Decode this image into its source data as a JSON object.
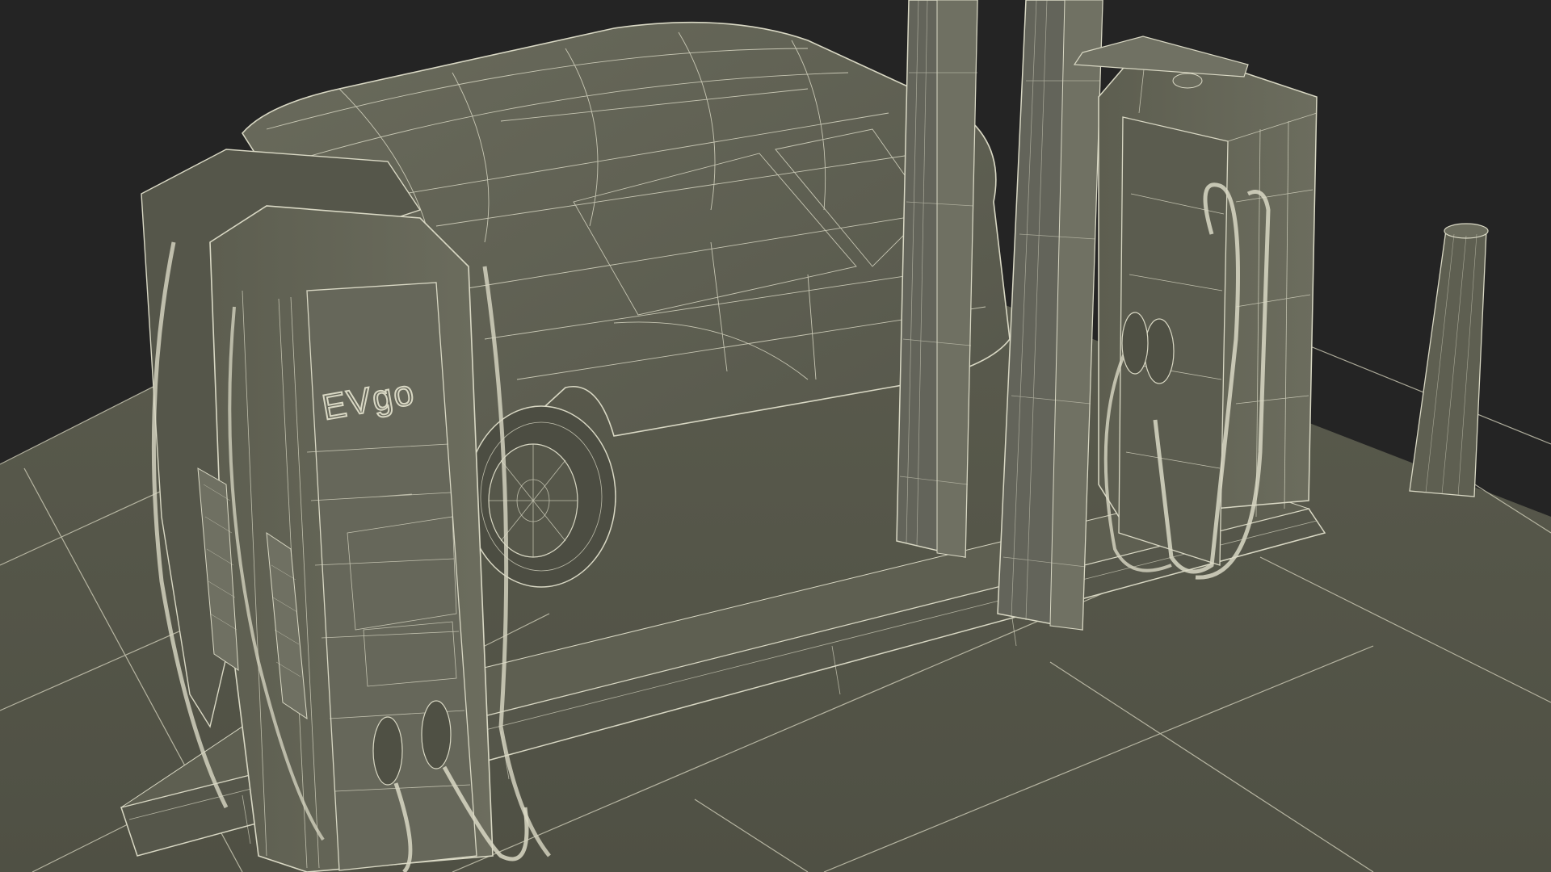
{
  "scene": {
    "description_type": "3d-wireframe-render",
    "colors": {
      "background": "#242424",
      "surface": "#5a5b4d",
      "surface_dark": "#4a4b3f",
      "wire": "#d9d8c4",
      "shadow": "#36372f"
    }
  },
  "charger": {
    "logo_text": "EVgo"
  }
}
